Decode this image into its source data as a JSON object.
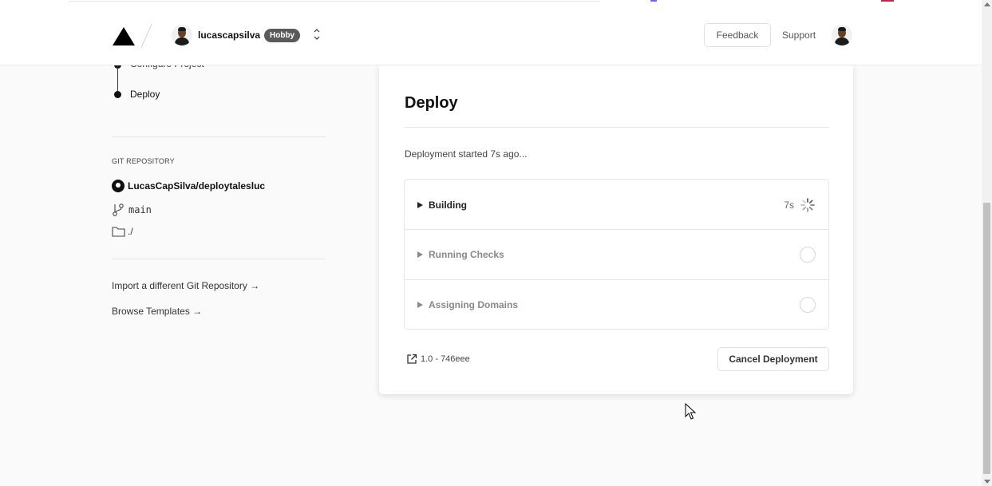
{
  "header": {
    "username": "lucascapsilva",
    "plan_badge": "Hobby",
    "scope_switcher_glyph": "⌃⌄",
    "feedback_label": "Feedback",
    "support_label": "Support",
    "icons": [
      "vercel-logo-icon",
      "avatar",
      "chevron-updown-icon"
    ]
  },
  "steps_nav": {
    "previous_label": "Configure Project",
    "current_label": "Deploy"
  },
  "git": {
    "heading": "GIT REPOSITORY",
    "repo": "LucasCapSilva/deploytalesluc",
    "branch": "main",
    "directory": "./",
    "import_link": "Import a different Git Repository →",
    "browse_link": "Browse Templates →"
  },
  "deploy": {
    "title": "Deploy",
    "status": "Deployment started 7s ago...",
    "steps": [
      {
        "label": "Building",
        "elapsed": "7s",
        "state": "running"
      },
      {
        "label": "Running Checks",
        "state": "pending"
      },
      {
        "label": "Assigning Domains",
        "state": "pending"
      }
    ],
    "commit_ref": "1.0 - 746eee",
    "cancel_label": "Cancel Deployment"
  },
  "colors": {
    "background": "#fafafa",
    "card": "#ffffff",
    "badge": "#5a5a5a",
    "text": "#111111",
    "muted": "#888888",
    "border": "#e6e6e6"
  }
}
